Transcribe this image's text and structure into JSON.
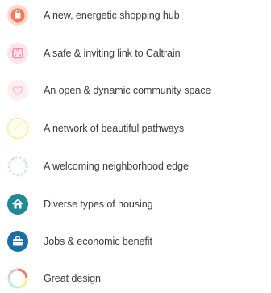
{
  "colors": {
    "text": "#3c3c3c",
    "shopping": "#f07a5a",
    "caltrain": "#f48ca6",
    "community": "#f6c6d4",
    "pathways": "#f4ec9a",
    "neighborhood_edge": "#bfe6e4",
    "housing": "#1f8a93",
    "jobs": "#1b6fa8",
    "design": "multicolor"
  },
  "benefits": [
    {
      "icon": "shopping-bag-icon",
      "label": "A new, energetic shopping hub"
    },
    {
      "icon": "train-icon",
      "label": "A safe & inviting link to Caltrain"
    },
    {
      "icon": "heart-icon",
      "label": "An open & dynamic community space"
    },
    {
      "icon": "pathway-icon",
      "label": "A network of beautiful pathways"
    },
    {
      "icon": "dotted-ring-icon",
      "label": "A welcoming neighborhood edge"
    },
    {
      "icon": "house-icon",
      "label": "Diverse types of housing"
    },
    {
      "icon": "briefcase-icon",
      "label": "Jobs & economic benefit"
    },
    {
      "icon": "color-ring-icon",
      "label": "Great design"
    }
  ]
}
